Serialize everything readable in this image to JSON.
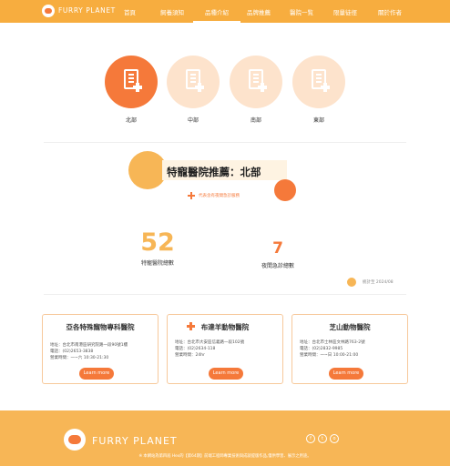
{
  "nav": {
    "brand": "FURRY PLANET",
    "items": [
      "首頁",
      "飼養須知",
      "品種介紹",
      "品牌推薦",
      "醫院一覧",
      "限量徒徑",
      "關於作者"
    ],
    "active_index": 2
  },
  "regions": [
    "北部",
    "中部",
    "南部",
    "東部"
  ],
  "active_region": 0,
  "section": {
    "title": "特寵醫院推薦：北部",
    "legend": "代表含有夜間急診服務"
  },
  "stats": {
    "hospitals": {
      "value": "52",
      "label": "特寵醫院總數"
    },
    "night": {
      "value": "7",
      "label": "夜間急診總數"
    },
    "updated": "統計至 2024/08"
  },
  "cards": [
    {
      "title": "亞各特殊寵物專科醫院",
      "has_night_icon": false,
      "address": "地址：台北市南港區研究院路一段90號1樓",
      "phone": "電話：(02)2653-3838",
      "hours": "營業時間：一~六 10:30-21:30",
      "button": "Learn more"
    },
    {
      "title": "布達羊動物醫院",
      "has_night_icon": true,
      "address": "地址：台北市大安區信義路一段102號",
      "phone": "電話：(02)2634-118",
      "hours": "營業時間：24hr",
      "button": "Learn more"
    },
    {
      "title": "芝山動物醫院",
      "has_night_icon": false,
      "address": "地址：台北市士林區文林路763-2號",
      "phone": "電話：(02)2832-9985",
      "hours": "營業時間：一~日 10:00-21:00",
      "button": "Learn more"
    }
  ],
  "footer": {
    "brand": "FURRY PLANET",
    "social": [
      "f",
      "t",
      "o"
    ],
    "note": "※ 本網站為第四屆 Hex的【第64期】前端工程師專業技術與成就提版作品,僅供學習、展示之用途。"
  },
  "colors": {
    "primary": "#f7ad3f",
    "accent": "#f5793a",
    "light": "#fde3cc",
    "footer": "#f7b656"
  }
}
